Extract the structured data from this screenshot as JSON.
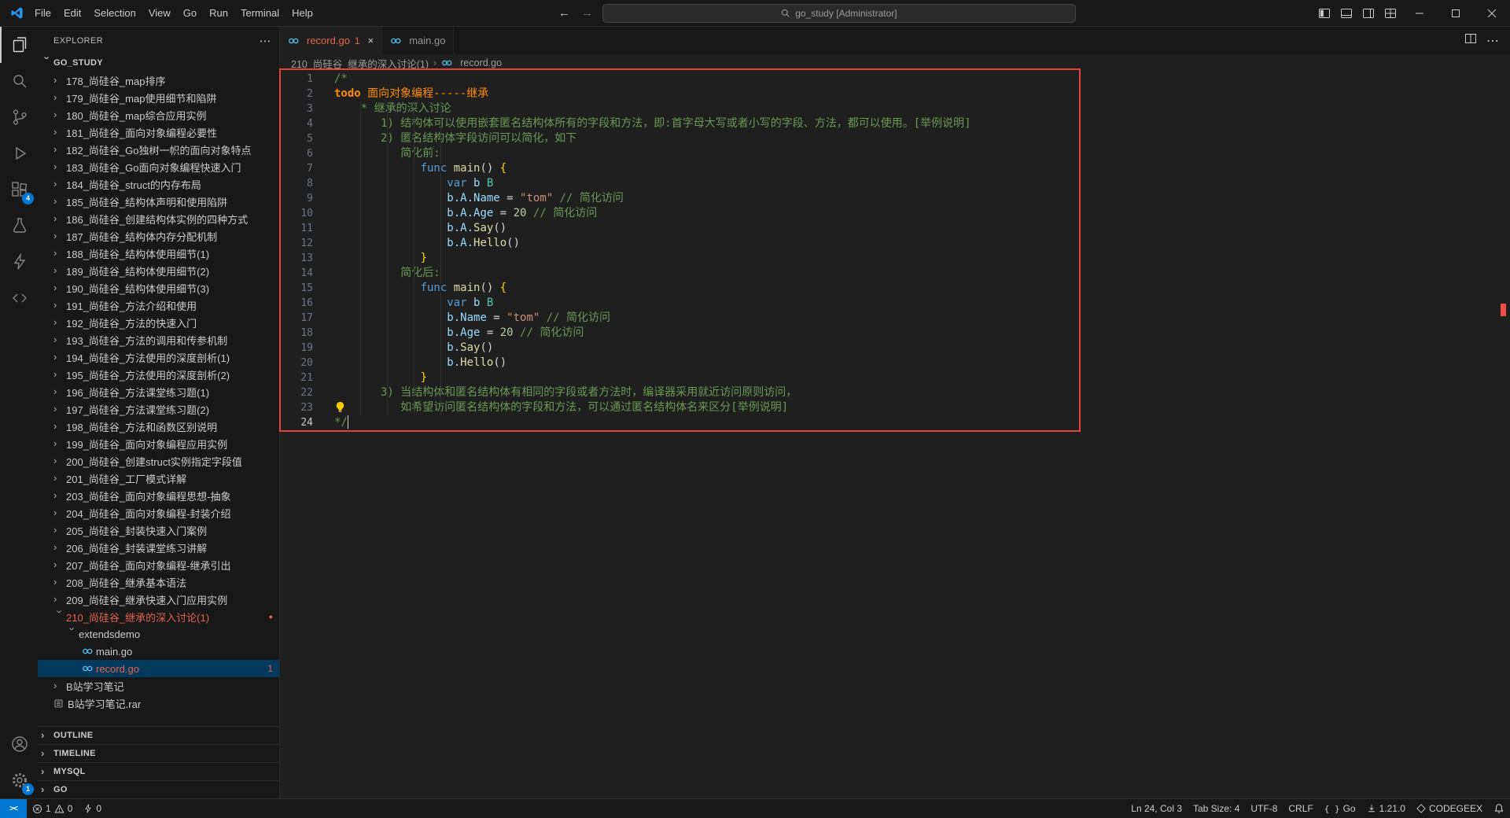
{
  "colors": {
    "accent": "#0078d4",
    "err": "#e5654e",
    "todo": "#ff8c00",
    "sel": "#04395e"
  },
  "window": {
    "command_center": "go_study [Administrator]"
  },
  "menubar": [
    "File",
    "Edit",
    "Selection",
    "View",
    "Go",
    "Run",
    "Terminal",
    "Help"
  ],
  "activity": {
    "extensions_badge": "4",
    "settings_badge": "1"
  },
  "explorer": {
    "title": "EXPLORER",
    "more": "⋯",
    "root": "GO_STUDY",
    "tree": [
      {
        "label": "178_尚硅谷_map排序",
        "kind": "folder",
        "level": 1
      },
      {
        "label": "179_尚硅谷_map使用细节和陷阱",
        "kind": "folder",
        "level": 1
      },
      {
        "label": "180_尚硅谷_map综合应用实例",
        "kind": "folder",
        "level": 1
      },
      {
        "label": "181_尚硅谷_面向对象编程必要性",
        "kind": "folder",
        "level": 1
      },
      {
        "label": "182_尚硅谷_Go独树一帜的面向对象特点",
        "kind": "folder",
        "level": 1
      },
      {
        "label": "183_尚硅谷_Go面向对象编程快速入门",
        "kind": "folder",
        "level": 1
      },
      {
        "label": "184_尚硅谷_struct的内存布局",
        "kind": "folder",
        "level": 1
      },
      {
        "label": "185_尚硅谷_结构体声明和使用陷阱",
        "kind": "folder",
        "level": 1
      },
      {
        "label": "186_尚硅谷_创建结构体实例的四种方式",
        "kind": "folder",
        "level": 1
      },
      {
        "label": "187_尚硅谷_结构体内存分配机制",
        "kind": "folder",
        "level": 1
      },
      {
        "label": "188_尚硅谷_结构体使用细节(1)",
        "kind": "folder",
        "level": 1
      },
      {
        "label": "189_尚硅谷_结构体使用细节(2)",
        "kind": "folder",
        "level": 1
      },
      {
        "label": "190_尚硅谷_结构体使用细节(3)",
        "kind": "folder",
        "level": 1
      },
      {
        "label": "191_尚硅谷_方法介绍和使用",
        "kind": "folder",
        "level": 1
      },
      {
        "label": "192_尚硅谷_方法的快速入门",
        "kind": "folder",
        "level": 1
      },
      {
        "label": "193_尚硅谷_方法的调用和传参机制",
        "kind": "folder",
        "level": 1
      },
      {
        "label": "194_尚硅谷_方法使用的深度剖析(1)",
        "kind": "folder",
        "level": 1
      },
      {
        "label": "195_尚硅谷_方法使用的深度剖析(2)",
        "kind": "folder",
        "level": 1
      },
      {
        "label": "196_尚硅谷_方法课堂练习题(1)",
        "kind": "folder",
        "level": 1
      },
      {
        "label": "197_尚硅谷_方法课堂练习题(2)",
        "kind": "folder",
        "level": 1
      },
      {
        "label": "198_尚硅谷_方法和函数区别说明",
        "kind": "folder",
        "level": 1
      },
      {
        "label": "199_尚硅谷_面向对象编程应用实例",
        "kind": "folder",
        "level": 1
      },
      {
        "label": "200_尚硅谷_创建struct实例指定字段值",
        "kind": "folder",
        "level": 1
      },
      {
        "label": "201_尚硅谷_工厂模式详解",
        "kind": "folder",
        "level": 1
      },
      {
        "label": "203_尚硅谷_面向对象编程思想-抽象",
        "kind": "folder",
        "level": 1
      },
      {
        "label": "204_尚硅谷_面向对象编程-封装介绍",
        "kind": "folder",
        "level": 1
      },
      {
        "label": "205_尚硅谷_封装快速入门案例",
        "kind": "folder",
        "level": 1
      },
      {
        "label": "206_尚硅谷_封装课堂练习讲解",
        "kind": "folder",
        "level": 1
      },
      {
        "label": "207_尚硅谷_面向对象编程-继承引出",
        "kind": "folder",
        "level": 1
      },
      {
        "label": "208_尚硅谷_继承基本语法",
        "kind": "folder",
        "level": 1
      },
      {
        "label": "209_尚硅谷_继承快速入门应用实例",
        "kind": "folder",
        "level": 1
      },
      {
        "label": "210_尚硅谷_继承的深入讨论(1)",
        "kind": "folder",
        "level": 1,
        "expanded": true,
        "error": true,
        "dot": true
      },
      {
        "label": "extendsdemo",
        "kind": "folder",
        "level": 2,
        "expanded": true
      },
      {
        "label": "main.go",
        "kind": "go",
        "level": 3
      },
      {
        "label": "record.go",
        "kind": "go",
        "level": 3,
        "selected": true,
        "error": true,
        "badge": "1"
      },
      {
        "label": "B站学习笔记",
        "kind": "folder",
        "level": 1
      },
      {
        "label": "B站学习笔记.rar",
        "kind": "rar",
        "level": 1
      }
    ],
    "sections": [
      "OUTLINE",
      "TIMELINE",
      "MYSQL",
      "GO"
    ]
  },
  "editor": {
    "tabs": [
      {
        "label": "record.go",
        "badge": "1",
        "active": true,
        "error": true
      },
      {
        "label": "main.go",
        "active": false
      }
    ],
    "breadcrumb": [
      "210_尚硅谷_继承的深入讨论(1)",
      "record.go"
    ],
    "lines": [
      {
        "n": 1,
        "segs": [
          [
            "c",
            "/*"
          ]
        ]
      },
      {
        "n": 2,
        "segs": [
          [
            "todob",
            "todo"
          ],
          [
            "todo",
            " 面向对象编程-----继承"
          ]
        ]
      },
      {
        "n": 3,
        "segs": [
          [
            "c",
            "    * 继承的深入讨论"
          ]
        ]
      },
      {
        "n": 4,
        "segs": [
          [
            "c",
            "       1) 结构体可以使用嵌套匿名结构体所有的字段和方法，即:首字母大写或者小写的字段、方法，都可以使用。[举例说明]"
          ]
        ]
      },
      {
        "n": 5,
        "segs": [
          [
            "c",
            "       2) 匿名结构体字段访问可以简化，如下"
          ]
        ]
      },
      {
        "n": 6,
        "segs": [
          [
            "c",
            "          简化前:"
          ]
        ]
      },
      {
        "n": 7,
        "segs": [
          [
            "p",
            "             "
          ],
          [
            "kw",
            "func"
          ],
          [
            "p",
            " "
          ],
          [
            "fn",
            "main"
          ],
          [
            "p",
            "() "
          ],
          [
            "br",
            "{"
          ]
        ]
      },
      {
        "n": 8,
        "segs": [
          [
            "p",
            "                 "
          ],
          [
            "kw",
            "var"
          ],
          [
            "p",
            " "
          ],
          [
            "v",
            "b"
          ],
          [
            "p",
            " "
          ],
          [
            "ty",
            "B"
          ]
        ]
      },
      {
        "n": 9,
        "segs": [
          [
            "p",
            "                 "
          ],
          [
            "v",
            "b.A.Name"
          ],
          [
            "p",
            " = "
          ],
          [
            "s",
            "\"tom\""
          ],
          [
            "p",
            " "
          ],
          [
            "c",
            "// 简化访问"
          ]
        ]
      },
      {
        "n": 10,
        "segs": [
          [
            "p",
            "                 "
          ],
          [
            "v",
            "b.A.Age"
          ],
          [
            "p",
            " = "
          ],
          [
            "nu",
            "20"
          ],
          [
            "p",
            " "
          ],
          [
            "c",
            "// 简化访问"
          ]
        ]
      },
      {
        "n": 11,
        "segs": [
          [
            "p",
            "                 "
          ],
          [
            "v",
            "b.A."
          ],
          [
            "fn",
            "Say"
          ],
          [
            "p",
            "()"
          ]
        ]
      },
      {
        "n": 12,
        "segs": [
          [
            "p",
            "                 "
          ],
          [
            "v",
            "b.A."
          ],
          [
            "fn",
            "Hello"
          ],
          [
            "p",
            "()"
          ]
        ]
      },
      {
        "n": 13,
        "segs": [
          [
            "p",
            "             "
          ],
          [
            "br",
            "}"
          ]
        ]
      },
      {
        "n": 14,
        "segs": [
          [
            "c",
            "          简化后:"
          ]
        ]
      },
      {
        "n": 15,
        "segs": [
          [
            "p",
            "             "
          ],
          [
            "kw",
            "func"
          ],
          [
            "p",
            " "
          ],
          [
            "fn",
            "main"
          ],
          [
            "p",
            "() "
          ],
          [
            "br",
            "{"
          ]
        ]
      },
      {
        "n": 16,
        "segs": [
          [
            "p",
            "                 "
          ],
          [
            "kw",
            "var"
          ],
          [
            "p",
            " "
          ],
          [
            "v",
            "b"
          ],
          [
            "p",
            " "
          ],
          [
            "ty",
            "B"
          ]
        ]
      },
      {
        "n": 17,
        "segs": [
          [
            "p",
            "                 "
          ],
          [
            "v",
            "b.Name"
          ],
          [
            "p",
            " = "
          ],
          [
            "s",
            "\"tom\""
          ],
          [
            "p",
            " "
          ],
          [
            "c",
            "// 简化访问"
          ]
        ]
      },
      {
        "n": 18,
        "segs": [
          [
            "p",
            "                 "
          ],
          [
            "v",
            "b.Age"
          ],
          [
            "p",
            " = "
          ],
          [
            "nu",
            "20"
          ],
          [
            "p",
            " "
          ],
          [
            "c",
            "// 简化访问"
          ]
        ]
      },
      {
        "n": 19,
        "segs": [
          [
            "p",
            "                 "
          ],
          [
            "v",
            "b."
          ],
          [
            "fn",
            "Say"
          ],
          [
            "p",
            "()"
          ]
        ]
      },
      {
        "n": 20,
        "segs": [
          [
            "p",
            "                 "
          ],
          [
            "v",
            "b."
          ],
          [
            "fn",
            "Hello"
          ],
          [
            "p",
            "()"
          ]
        ]
      },
      {
        "n": 21,
        "segs": [
          [
            "p",
            "             "
          ],
          [
            "br",
            "}"
          ]
        ]
      },
      {
        "n": 22,
        "segs": [
          [
            "c",
            "       3) 当结构体和匿名结构体有相同的字段或者方法时，编译器采用就近访问原则访问，"
          ]
        ]
      },
      {
        "n": 23,
        "segs": [
          [
            "c",
            "          如希望访问匿名结构体的字段和方法，可以通过匿名结构体名来区分[举例说明]"
          ]
        ]
      },
      {
        "n": 24,
        "segs": [
          [
            "c",
            "*/"
          ]
        ],
        "cursor": true,
        "active": true
      }
    ]
  },
  "status": {
    "errors": "1",
    "warnings": "0",
    "extra": "0",
    "line_col": "Ln 24, Col 3",
    "tab_size": "Tab Size: 4",
    "encoding": "UTF-8",
    "eol": "CRLF",
    "language": "Go",
    "go_version": "1.21.0",
    "codegeex": "CODEGEEX"
  }
}
